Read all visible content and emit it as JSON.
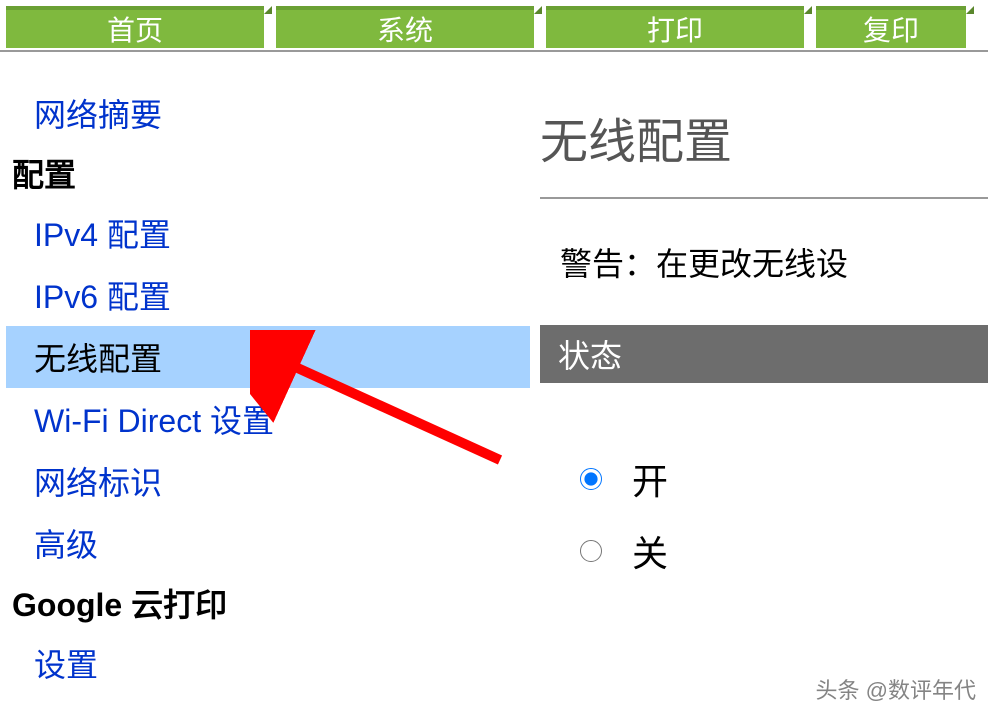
{
  "tabs": {
    "home": "首页",
    "system": "系统",
    "print": "打印",
    "copy": "复印"
  },
  "sidebar": {
    "network_summary": "网络摘要",
    "config_heading": "配置",
    "ipv4": "IPv4 配置",
    "ipv6": "IPv6 配置",
    "wireless": "无线配置",
    "wifi_direct": "Wi-Fi Direct 设置",
    "network_id": "网络标识",
    "advanced": "高级",
    "google_heading": "Google 云打印",
    "settings": "设置"
  },
  "main": {
    "title": "无线配置",
    "warning": "警告：在更改无线设",
    "status_label": "状态",
    "radio_on": "开",
    "radio_off": "关"
  },
  "watermark": "头条 @数评年代"
}
